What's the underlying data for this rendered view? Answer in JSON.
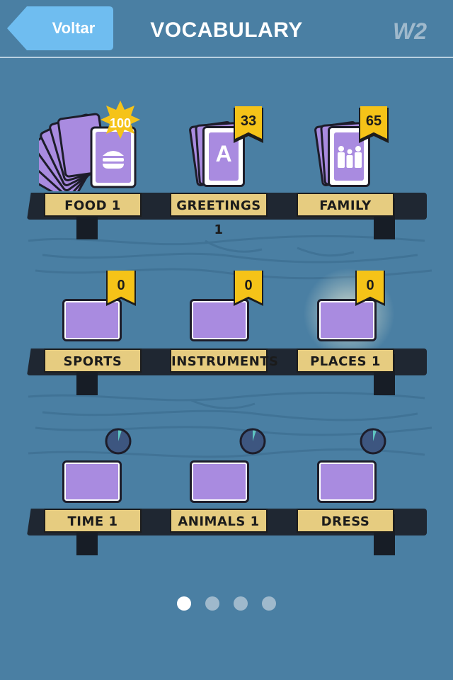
{
  "header": {
    "back_label": "Voltar",
    "title": "VOCABULARY",
    "logo": "W2"
  },
  "colors": {
    "background": "#4a7fa3",
    "card_purple": "#a98be0",
    "flag_yellow": "#f5c318",
    "label_tan": "#e6cc80",
    "shelf_dark": "#1f2732"
  },
  "shelves": [
    {
      "items": [
        {
          "label": "FOOD 1",
          "count": "100",
          "state": "deck",
          "badge": "star",
          "icon": "burger-icon"
        },
        {
          "label": "GREETINGS 1",
          "count": "33",
          "state": "deck",
          "badge": "flag",
          "icon": "letter-a-icon",
          "icon_text": "A"
        },
        {
          "label": "FAMILY",
          "count": "65",
          "state": "deck",
          "badge": "flag",
          "icon": "family-icon"
        }
      ]
    },
    {
      "items": [
        {
          "label": "SPORTS",
          "count": "0",
          "state": "empty",
          "badge": "flag"
        },
        {
          "label": "INSTRUMENTS",
          "count": "0",
          "state": "empty",
          "badge": "flag"
        },
        {
          "label": "PLACES 1",
          "count": "0",
          "state": "empty",
          "badge": "flag",
          "highlighted": true
        }
      ]
    },
    {
      "items": [
        {
          "label": "TIME 1",
          "state": "locked",
          "badge": "timer",
          "icon": "timer-icon",
          "timer_fraction": 0.05
        },
        {
          "label": "ANIMALS 1",
          "state": "locked",
          "badge": "timer",
          "icon": "timer-icon",
          "timer_fraction": 0.05
        },
        {
          "label": "DRESS",
          "state": "locked",
          "badge": "timer",
          "icon": "timer-icon",
          "timer_fraction": 0.05
        }
      ]
    }
  ],
  "pager": {
    "pages": 4,
    "current": 1
  }
}
